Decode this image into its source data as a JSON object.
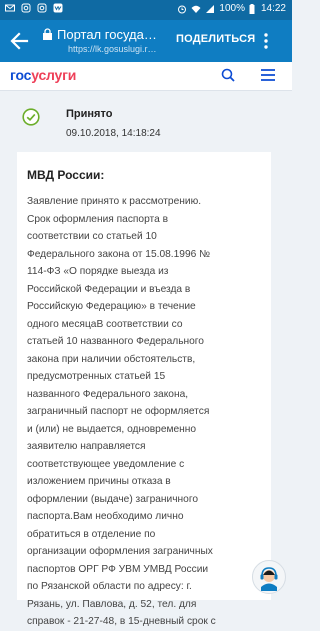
{
  "status_bar": {
    "battery": "100%",
    "time": "14:22"
  },
  "browser": {
    "title": "Портал госуда…",
    "url": "https://lk.gosuslugi.r…",
    "share_label": "ПОДЕЛИТЬСЯ"
  },
  "site": {
    "logo_part1": "гос",
    "logo_part2": "услуги"
  },
  "status": {
    "label": "Принято",
    "datetime": "09.10.2018, 14:18:24"
  },
  "message": {
    "sender": "МВД России:",
    "lines": [
      "Заявление принято к рассмотрению.",
      "Срок оформления паспорта в",
      "соответствии со статьей 10",
      "Федерального закона от 15.08.1996 №",
      "114-ФЗ «О порядке выезда из",
      "Российской Федерации и въезда в",
      "Российскую Федерацию» в течение",
      "одного месяцаВ соответствии со",
      "статьей 10 названного Федерального",
      "закона при наличии обстоятельств,",
      "предусмотренных статьей 15",
      "названного Федерального закона,",
      "заграничный паспорт не оформляется",
      "и (или) не выдается, одновременно",
      "заявителю направляется",
      "соответствующее уведомление с",
      "изложением причины отказа в",
      "оформлении (выдаче) заграничного",
      "паспорта.Вам необходимо лично",
      "обратиться в отделение по",
      "организации оформления заграничных",
      "паспортов ОРГ РФ УВМ УМВД России",
      "по Рязанской области по адресу: г.",
      "Рязань, ул. Павлова, д. 52, тел. для",
      "справок - 21-27-48, в 15-дневный срок с"
    ]
  },
  "colors": {
    "status_bar": "#0f6aa3",
    "app_bar": "#0f7dc2",
    "logo_blue": "#0d4cd3",
    "logo_red": "#ee3f58",
    "check_green": "#6cae2b"
  }
}
